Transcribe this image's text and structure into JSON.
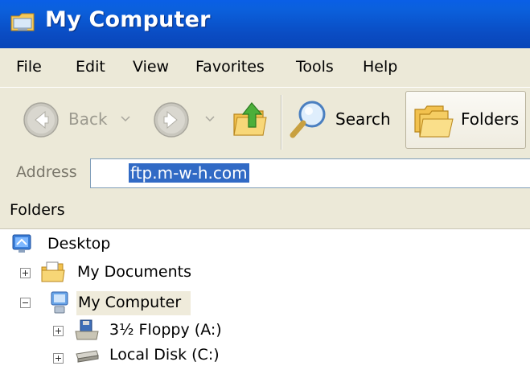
{
  "window": {
    "title": "My Computer"
  },
  "menu": [
    "File",
    "Edit",
    "View",
    "Favorites",
    "Tools",
    "Help"
  ],
  "toolbar": {
    "back_label": "Back",
    "search_label": "Search",
    "folders_label": "Folders"
  },
  "address": {
    "label": "Address",
    "value": "ftp.m-w-h.com"
  },
  "folders_pane": {
    "title": "Folders"
  },
  "tree": [
    {
      "label": "Desktop",
      "icon": "desktop-icon"
    },
    {
      "label": "My Documents",
      "icon": "my-documents-icon",
      "expander": "plus"
    },
    {
      "label": "My Computer",
      "icon": "my-computer-icon",
      "expander": "minus",
      "selected": true
    },
    {
      "label": "3½ Floppy (A:)",
      "icon": "floppy-drive-icon",
      "expander": "plus"
    },
    {
      "label": "Local Disk (C:)",
      "icon": "local-disk-icon",
      "expander": "plus"
    }
  ],
  "colors": {
    "titlebar": "#0a5fe6",
    "chrome": "#ece9d8",
    "selection": "#316ac5"
  }
}
